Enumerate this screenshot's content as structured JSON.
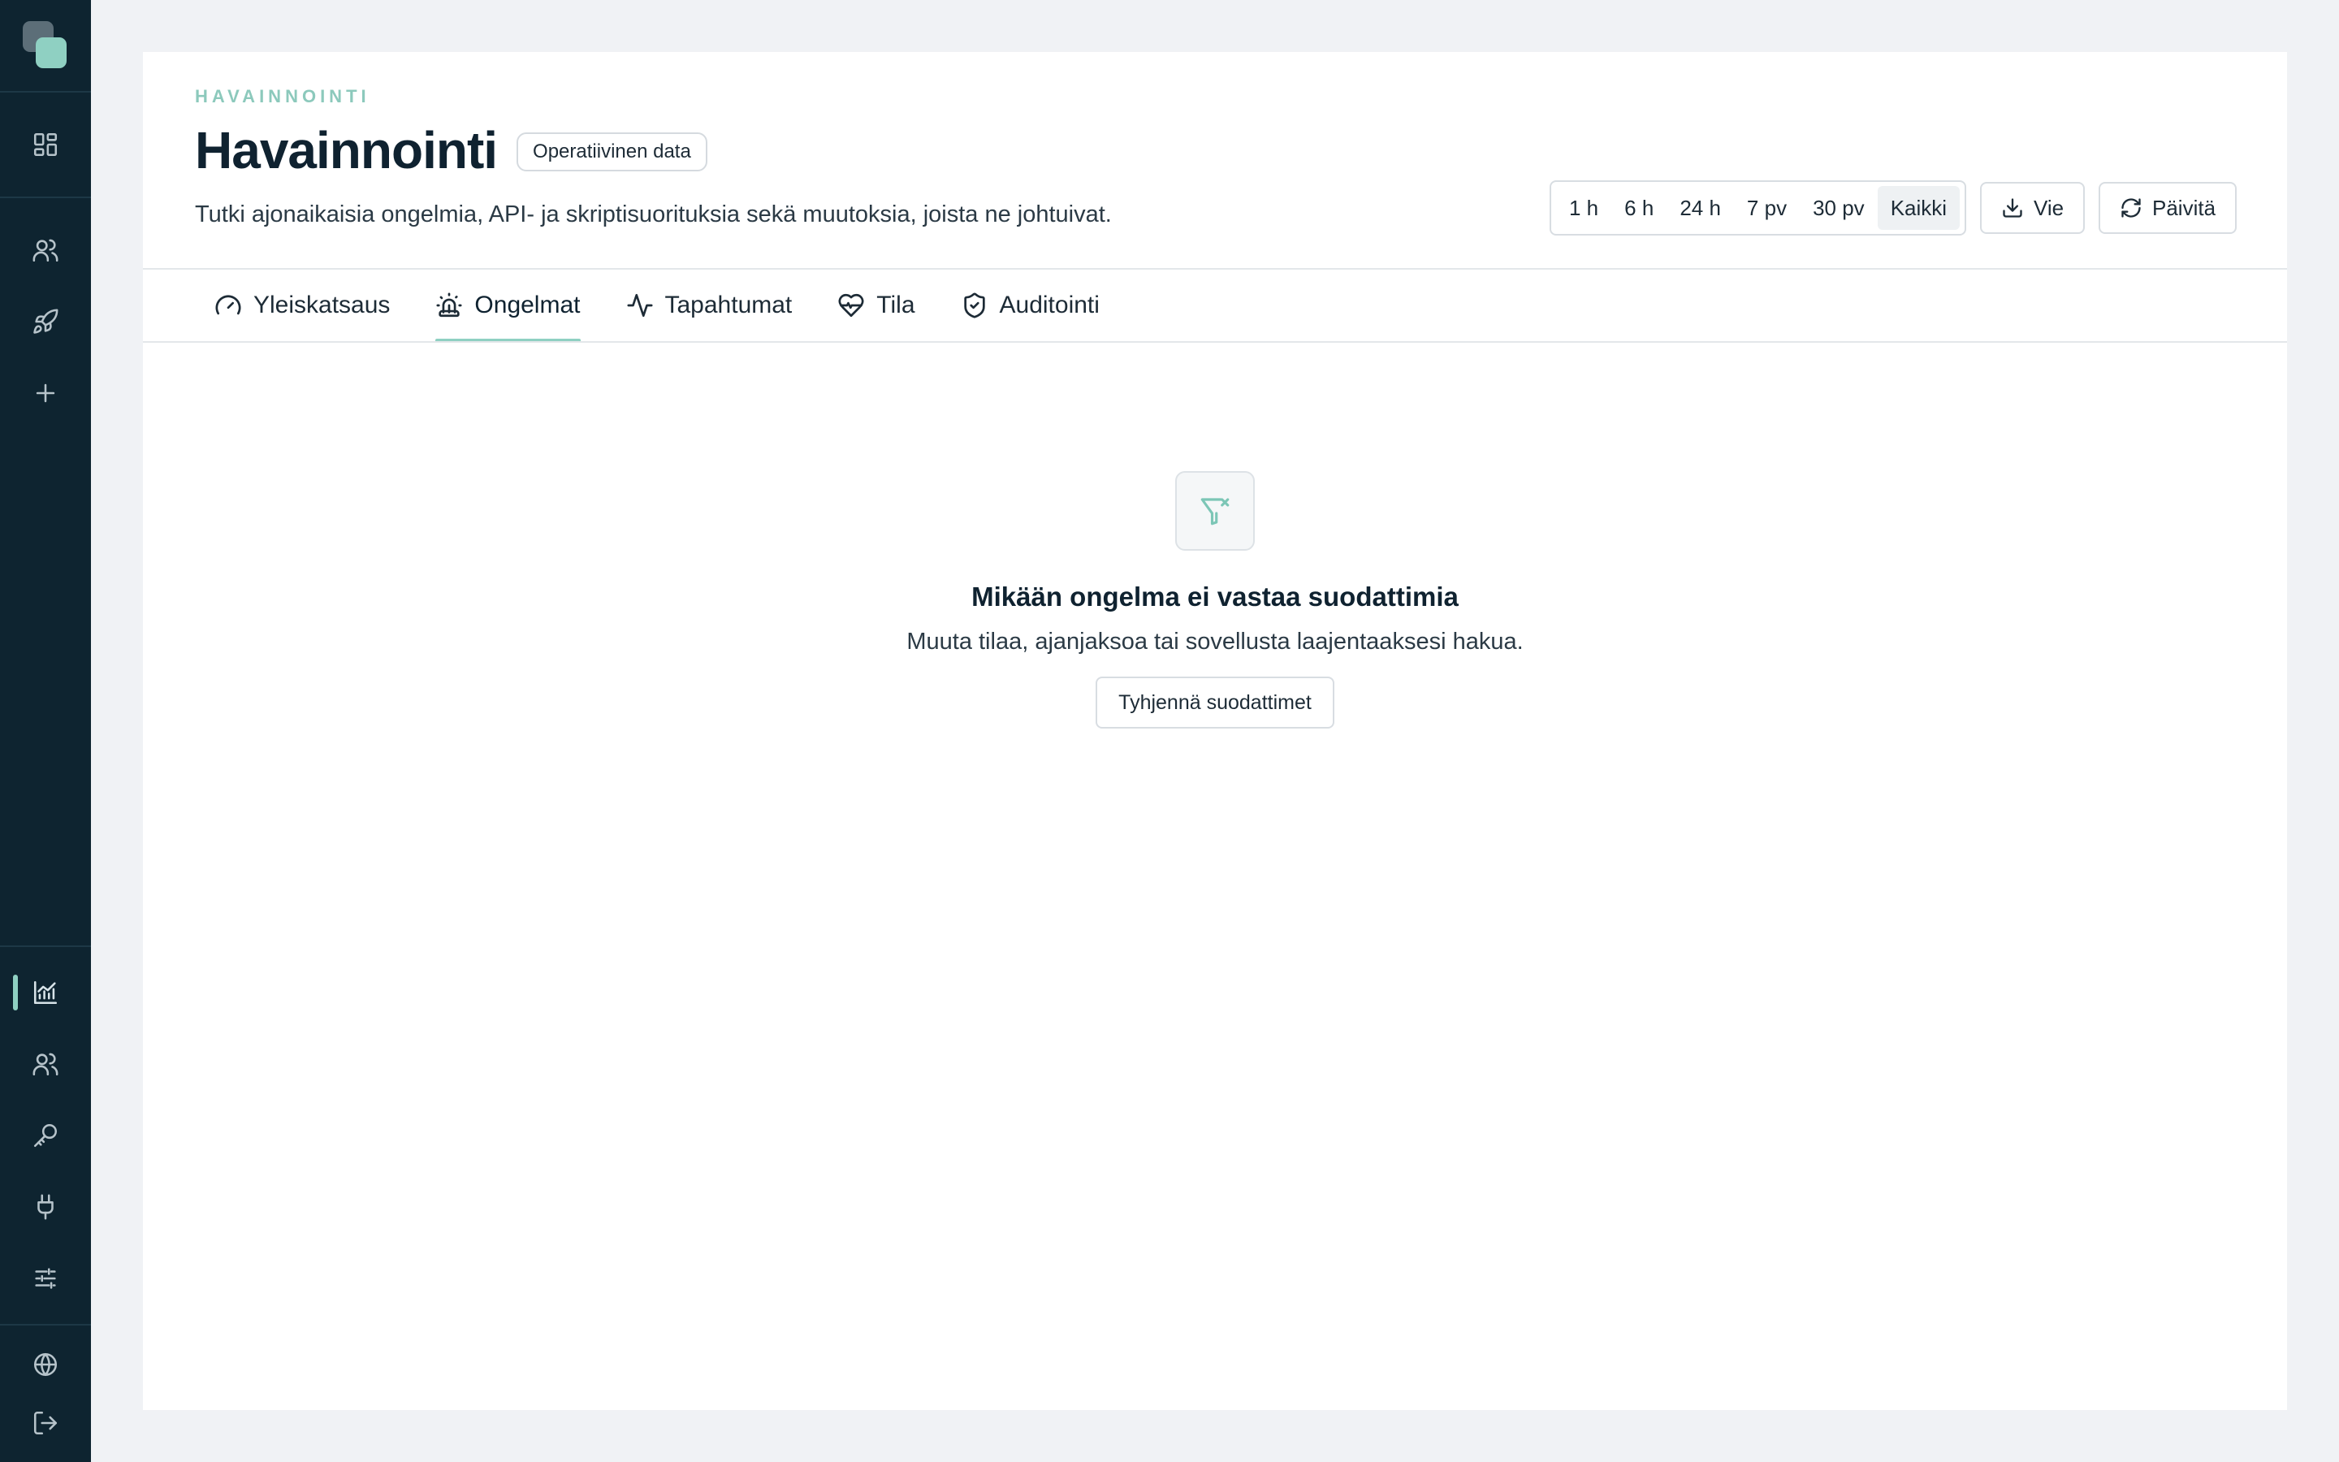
{
  "sidebar": {
    "top_items": [
      {
        "name": "dashboard-icon"
      },
      {
        "name": "users-icon"
      },
      {
        "name": "rocket-icon"
      },
      {
        "name": "plus-icon"
      }
    ],
    "bottom_items": [
      {
        "name": "chart-icon",
        "active": true
      },
      {
        "name": "users-icon"
      },
      {
        "name": "key-icon"
      },
      {
        "name": "plug-icon"
      },
      {
        "name": "sliders-icon"
      }
    ],
    "footer_items": [
      {
        "name": "globe-icon"
      },
      {
        "name": "logout-icon"
      }
    ]
  },
  "header": {
    "eyebrow": "HAVAINNOINTI",
    "title": "Havainnointi",
    "badge": "Operatiivinen data",
    "subtitle": "Tutki ajonaikaisia ongelmia, API- ja skriptisuorituksia sekä muutoksia, joista ne johtuivat."
  },
  "time_ranges": {
    "options": [
      "1 h",
      "6 h",
      "24 h",
      "7 pv",
      "30 pv",
      "Kaikki"
    ],
    "selected": "Kaikki"
  },
  "actions": {
    "export_label": "Vie",
    "refresh_label": "Päivitä"
  },
  "tabs": [
    {
      "label": "Yleiskatsaus",
      "icon": "gauge-icon"
    },
    {
      "label": "Ongelmat",
      "icon": "siren-icon",
      "active": true
    },
    {
      "label": "Tapahtumat",
      "icon": "activity-icon"
    },
    {
      "label": "Tila",
      "icon": "heart-pulse-icon"
    },
    {
      "label": "Auditointi",
      "icon": "shield-check-icon"
    }
  ],
  "empty_state": {
    "icon": "filter-x-icon",
    "title": "Mikään ongelma ei vastaa suodattimia",
    "text": "Muuta tilaa, ajanjaksoa tai sovellusta laajentaaksesi hakua.",
    "button_label": "Tyhjennä suodattimet"
  },
  "colors": {
    "sidebar_bg": "#0e2430",
    "accent": "#8fd0c2",
    "page_bg": "#f0f2f5"
  }
}
